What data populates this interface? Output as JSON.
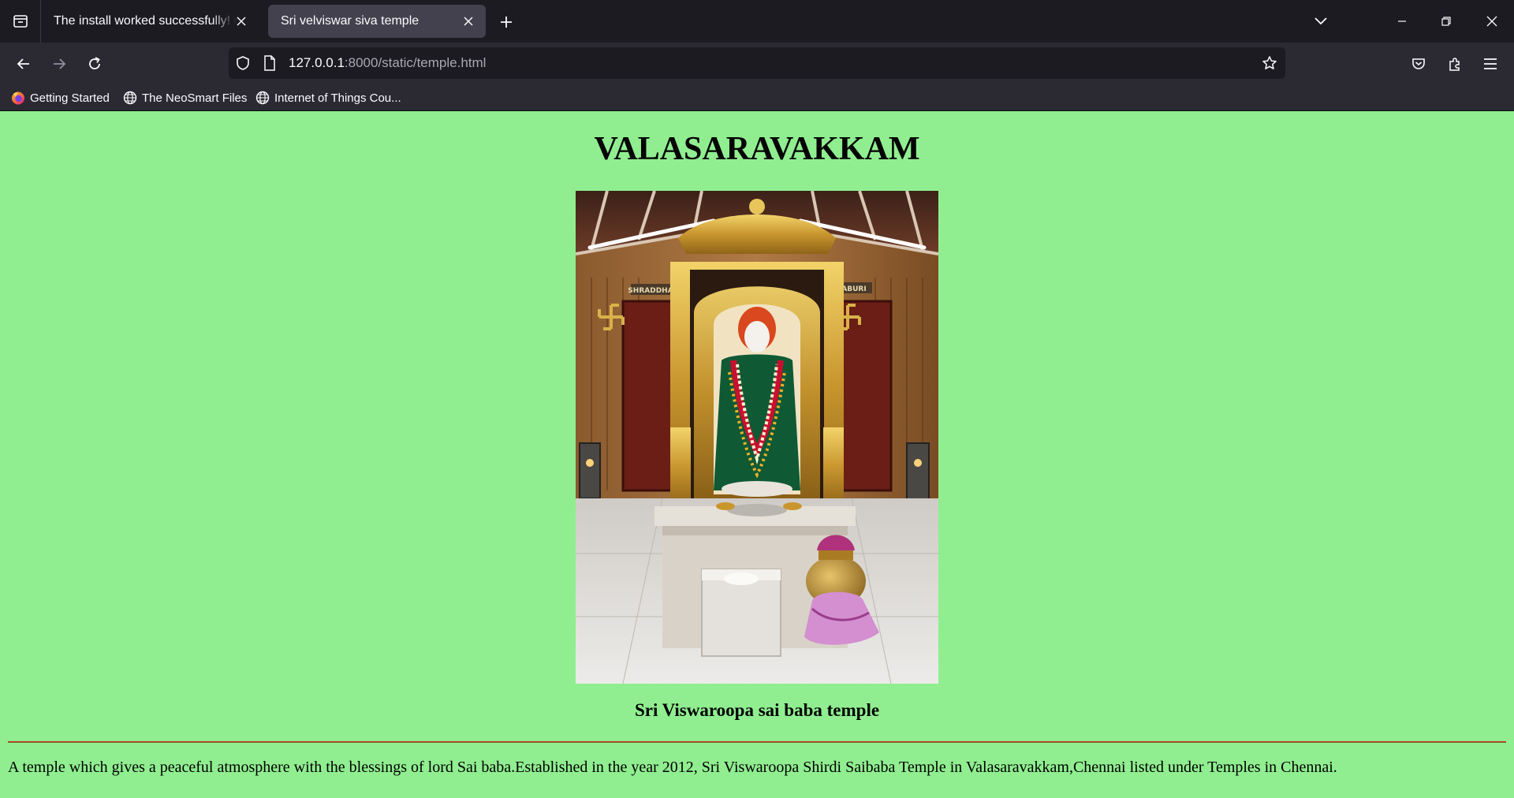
{
  "browser": {
    "tabs": [
      {
        "title": "The install worked successfully! Congratulations!",
        "active": false
      },
      {
        "title": "Sri velviswar siva temple",
        "active": true
      }
    ],
    "url": {
      "host": "127.0.0.1",
      "rest": ":8000/static/temple.html"
    },
    "bookmarks": [
      {
        "label": "Getting Started",
        "icon": "firefox-icon"
      },
      {
        "label": "The NeoSmart Files",
        "icon": "globe-icon"
      },
      {
        "label": "Internet of Things Cou...",
        "icon": "globe-icon"
      }
    ],
    "colors": {
      "tabstrip": "#1c1b22",
      "toolbar": "#2b2a33",
      "active_tab": "#42414d",
      "text": "#fbfbfe"
    }
  },
  "page": {
    "heading": "VALASARAVAKKAM",
    "image": {
      "labels": [
        "SHRADDHA",
        "ABURI"
      ]
    },
    "caption": "Sri Viswaroopa sai baba temple",
    "description": "A temple which gives a peaceful atmosphere with the blessings of lord Sai baba.Established in the year 2012, Sri Viswaroopa Shirdi Saibaba Temple in Valasaravakkam,Chennai listed under Temples in Chennai.",
    "colors": {
      "background": "#90ee90",
      "rule": "#cc2b1d"
    }
  }
}
